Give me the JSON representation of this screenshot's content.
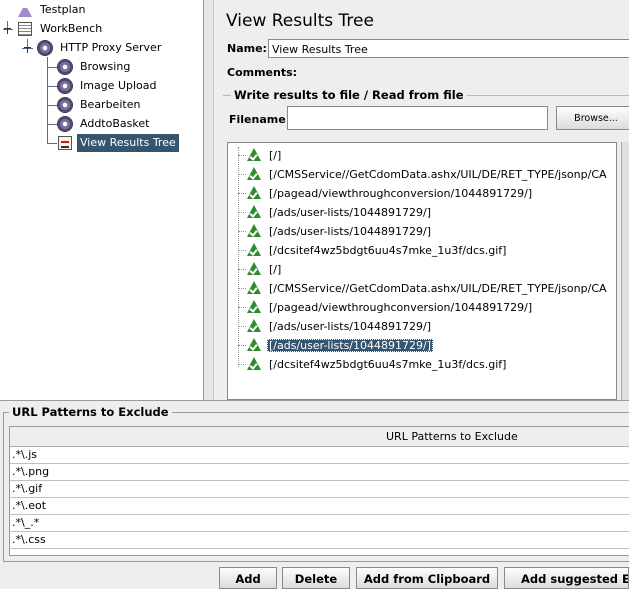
{
  "tree": {
    "items": [
      {
        "label": "Testplan",
        "icon": "flask-icon"
      },
      {
        "label": "WorkBench",
        "icon": "workbench-icon"
      },
      {
        "label": "HTTP Proxy Server",
        "icon": "gear-icon"
      },
      {
        "label": "Browsing",
        "icon": "gear-icon"
      },
      {
        "label": "Image Upload",
        "icon": "gear-icon"
      },
      {
        "label": "Bearbeiten",
        "icon": "gear-icon"
      },
      {
        "label": "AddtoBasket",
        "icon": "gear-icon"
      },
      {
        "label": "View Results Tree",
        "icon": "view-results-icon",
        "selected": true
      }
    ]
  },
  "panel": {
    "title": "View Results Tree",
    "name_label": "Name:",
    "name_value": "View Results Tree",
    "comments_label": "Comments:",
    "file_group_title": "Write results to file / Read from file",
    "filename_label": "Filename",
    "filename_value": "",
    "browse_label": "Browse..."
  },
  "results": [
    "[/]",
    "[/CMSService//GetCdomData.ashx/UIL/DE/RET_TYPE/jsonp/CA",
    "[/pagead/viewthroughconversion/1044891729/]",
    "[/ads/user-lists/1044891729/]",
    "[/ads/user-lists/1044891729/]",
    "[/dcsitef4wz5bdgt6uu4s7mke_1u3f/dcs.gif]",
    "[/]",
    "[/CMSService//GetCdomData.ashx/UIL/DE/RET_TYPE/jsonp/CA",
    "[/pagead/viewthroughconversion/1044891729/]",
    "[/ads/user-lists/1044891729/]",
    "[/ads/user-lists/1044891729/]",
    "[/dcsitef4wz5bdgt6uu4s7mke_1u3f/dcs.gif]"
  ],
  "selected_result_index": 10,
  "exclude": {
    "title": "URL Patterns to Exclude",
    "column_header": "URL Patterns to Exclude",
    "rows": [
      ".*\\.js",
      ".*\\.png",
      ".*\\.gif",
      ".*\\.eot",
      ".*\\_.*",
      ".*\\.css"
    ]
  },
  "buttons": {
    "add": "Add",
    "delete": "Delete",
    "add_from_clipboard": "Add from Clipboard",
    "add_suggested": "Add suggested Exc"
  },
  "colors": {
    "selection": "#35556f",
    "ok_icon": "#2e8b2e"
  }
}
